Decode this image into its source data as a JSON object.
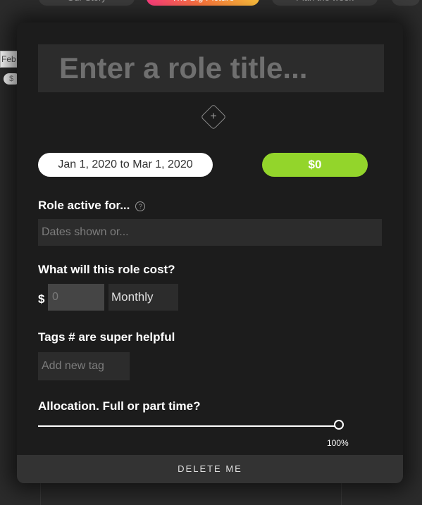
{
  "background": {
    "tabs": [
      "Our Story",
      "The Big Picture",
      "Plan the week",
      ""
    ],
    "side_label": "Feb",
    "side_pill": "$"
  },
  "modal": {
    "title_placeholder": "Enter a role title...",
    "add_icon": "plus-diamond-icon",
    "date_range": "Jan 1, 2020 to  Mar 1, 2020",
    "cost_total": "$0",
    "role_active_label": "Role active for...",
    "role_active_placeholder": "Dates shown or...",
    "cost_label": "What will this role cost?",
    "currency_symbol": "$",
    "cost_placeholder": "0",
    "cost_period": "Monthly",
    "tags_label": "Tags # are super helpful",
    "tags_placeholder": "Add new tag",
    "allocation_label": "Allocation. Full or part time?",
    "allocation_value": "100%",
    "allocation_fraction": 1.0,
    "delete_label": "DELETE ME"
  },
  "colors": {
    "modal_bg": "#1c1c1c",
    "cost_pill": "#93d52b",
    "field_bg": "#2c2c2c"
  }
}
